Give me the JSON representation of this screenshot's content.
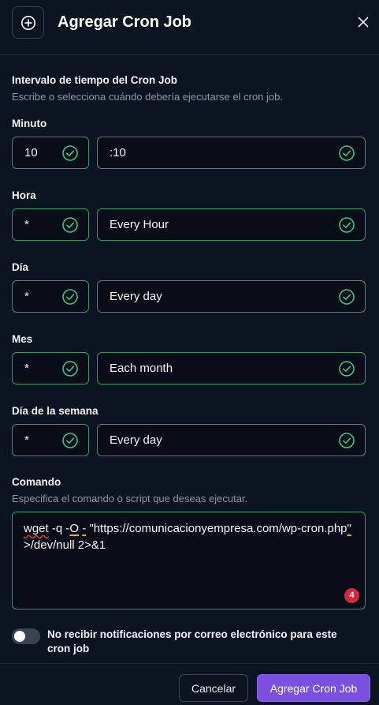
{
  "header": {
    "title": "Agregar Cron Job",
    "icon": "plus-circle-icon",
    "close_icon": "close-icon"
  },
  "interval": {
    "title": "Intervalo de tiempo del Cron Job",
    "description": "Escribe o selecciona cuándo debería ejecutarse el cron job."
  },
  "fields": {
    "minute": {
      "label": "Minuto",
      "value": "10",
      "select": ":10"
    },
    "hour": {
      "label": "Hora",
      "value": "*",
      "select": "Every Hour"
    },
    "day": {
      "label": "Día",
      "value": "*",
      "select": "Every day"
    },
    "month": {
      "label": "Mes",
      "value": "*",
      "select": "Each month"
    },
    "weekday": {
      "label": "Día de la semana",
      "value": "*",
      "select": "Every day"
    }
  },
  "command": {
    "label": "Comando",
    "description": "Especifica el comando o script que deseas ejecutar.",
    "seg1": "wget",
    "seg2": " -q -",
    "seg3": "O",
    "seg4": " ",
    "seg5": "-",
    "seg6": " \"https://comunicacionyempresa.com/wp-cron.php",
    "seg7": "\"",
    "seg8": " >/dev/null 2>&1",
    "issue_count": "4"
  },
  "notifications": {
    "label": "No recibir notificaciones por correo electrónico para este cron job",
    "enabled": false
  },
  "footer": {
    "cancel_label": "Cancelar",
    "submit_label": "Agregar Cron Job"
  },
  "colors": {
    "background": "#0d1421",
    "field_border": "#2f9a68",
    "check": "#3cc486",
    "primary": "#7b4fe0",
    "badge": "#d7263d"
  }
}
